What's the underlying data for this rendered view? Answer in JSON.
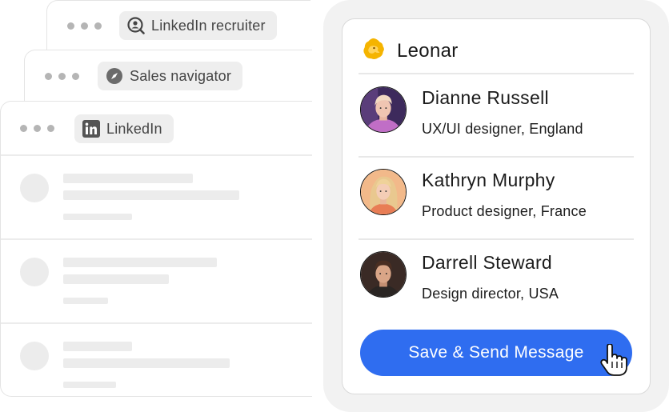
{
  "windows": [
    {
      "tab_label": "LinkedIn recruiter",
      "icon": "search-person-icon"
    },
    {
      "tab_label": "Sales navigator",
      "icon": "compass-icon"
    },
    {
      "tab_label": "LinkedIn",
      "icon": "linkedin-icon"
    }
  ],
  "panel": {
    "brand": "Leonar",
    "people": [
      {
        "name": "Dianne Russell",
        "role": "UX/UI designer, England"
      },
      {
        "name": "Kathryn Murphy",
        "role": "Product designer, France"
      },
      {
        "name": "Darrell Steward",
        "role": "Design director, USA"
      }
    ],
    "cta_label": "Save & Send Message"
  },
  "colors": {
    "accent": "#2f6df0",
    "brand": "#f5b400"
  }
}
